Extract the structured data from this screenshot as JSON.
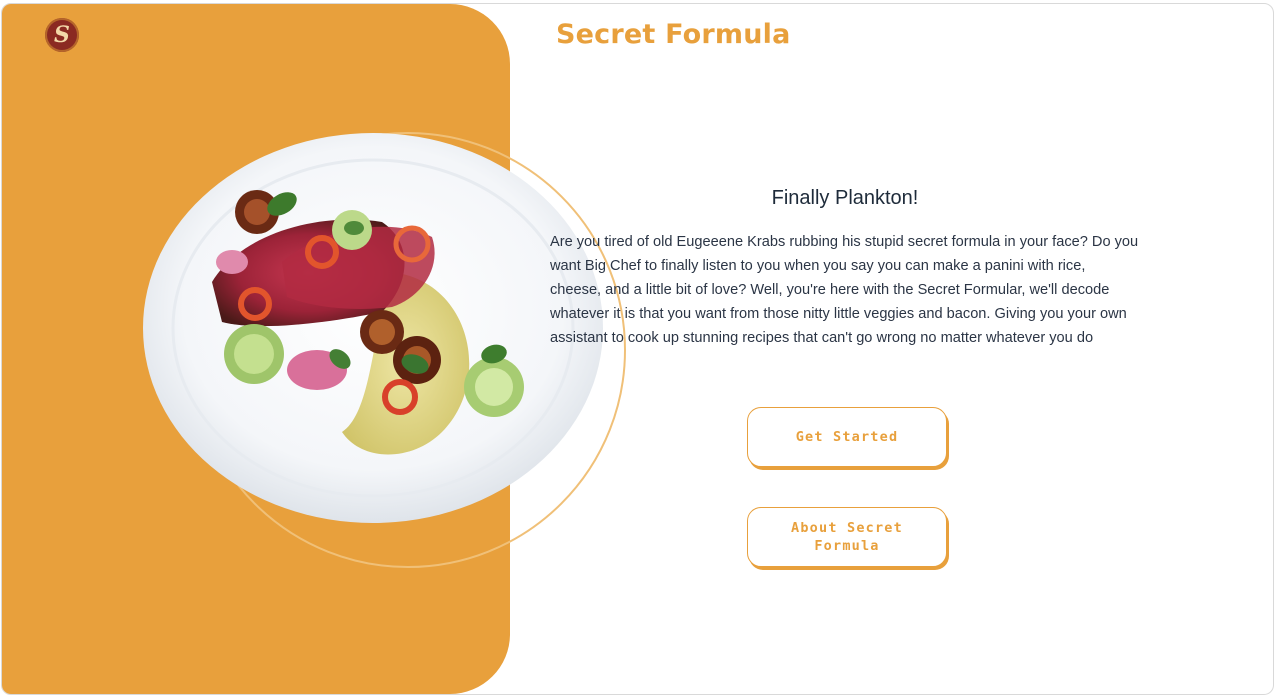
{
  "header": {
    "logo_letter": "S",
    "title": "Secret Formula"
  },
  "hero": {
    "image": "plated-steak-dish",
    "heading": "Finally Plankton!",
    "description": "Are you tired of old Eugeeene Krabs rubbing his stupid secret formula in your face? Do you want Big Chef to finally listen to you when you say you can make a panini with rice, cheese, and a little bit of love? Well, you're here with the Secret Formular, we'll decode whatever it is that you want from those nitty little veggies and bacon. Giving you your own assistant to cook up stunning recipes that can't go wrong no matter whatever you do"
  },
  "actions": {
    "get_started_label": "Get Started",
    "about_label": "About Secret Formula"
  },
  "colors": {
    "accent": "#e8a03c",
    "text": "#1e2b3a",
    "logo_bg": "#8b2a22"
  }
}
